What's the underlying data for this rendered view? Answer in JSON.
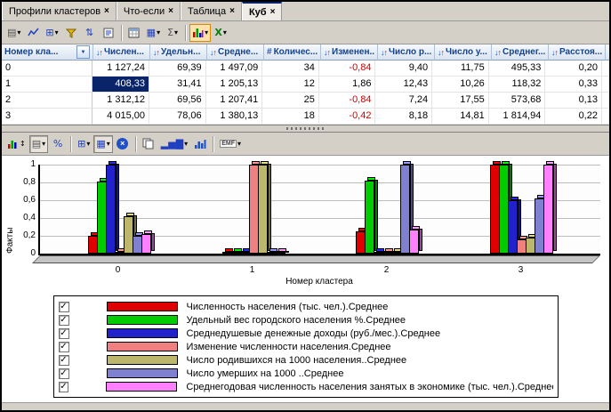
{
  "tabs": {
    "items": [
      {
        "label": "Профили кластеров"
      },
      {
        "label": "Что-если"
      },
      {
        "label": "Таблица"
      },
      {
        "label": "Куб"
      }
    ],
    "active_index": 3
  },
  "icons": {
    "close": "×",
    "dropdown": "▾",
    "filter_arrow": "▼",
    "sort_down": "↓",
    "sort_up": "↑",
    "hash": "#",
    "check": "✓",
    "excel": "X",
    "emf": "EMF",
    "sum": "Σ",
    "percent": "%",
    "sort_pair": "⇅",
    "bars_small": "▂▅▇",
    "updown": "↕",
    "grid": "▦",
    "doc": "▤",
    "plus_grid": "⊞"
  },
  "table": {
    "columns": [
      {
        "label": "Номер кла...",
        "icon": "filter-dropdown"
      },
      {
        "label": "Числен...",
        "icon": "sort"
      },
      {
        "label": "Удельн...",
        "icon": "sort"
      },
      {
        "label": "Средне...",
        "icon": "sort"
      },
      {
        "label": "Количес...",
        "icon": "hash"
      },
      {
        "label": "Изменен...",
        "icon": "sort"
      },
      {
        "label": "Число р...",
        "icon": "sort"
      },
      {
        "label": "Число у...",
        "icon": "sort"
      },
      {
        "label": "Среднег...",
        "icon": "sort"
      },
      {
        "label": "Расстоя...",
        "icon": "sort"
      }
    ],
    "rows": [
      {
        "id": "0",
        "cells": [
          "1 127,24",
          "69,39",
          "1 497,09",
          "34",
          "-0,84",
          "9,40",
          "11,75",
          "495,33",
          "0,20"
        ]
      },
      {
        "id": "1",
        "cells": [
          "408,33",
          "31,41",
          "1 205,13",
          "12",
          "1,86",
          "12,43",
          "10,26",
          "118,32",
          "0,33"
        ]
      },
      {
        "id": "2",
        "cells": [
          "1 312,12",
          "69,56",
          "1 207,41",
          "25",
          "-0,84",
          "7,24",
          "17,55",
          "573,68",
          "0,13"
        ]
      },
      {
        "id": "3",
        "cells": [
          "4 015,00",
          "78,06",
          "1 380,13",
          "18",
          "-0,42",
          "8,18",
          "14,81",
          "1 814,94",
          "0,22"
        ]
      }
    ],
    "selected_cell": {
      "row": 1,
      "col": 0
    }
  },
  "chart_data": {
    "type": "bar",
    "title": "",
    "xlabel": "Номер кластера",
    "ylabel": "Факты",
    "ylim": [
      0,
      1
    ],
    "yticks": [
      "0",
      "0,2",
      "0,4",
      "0,6",
      "0,8",
      "1"
    ],
    "categories": [
      "0",
      "1",
      "2",
      "3"
    ],
    "legend_position": "bottom",
    "grid": true,
    "series": [
      {
        "name": "Численность населения (тыс. чел.).Среднее",
        "color": "#e00000",
        "values": [
          0.2,
          0.0,
          0.25,
          1.0
        ]
      },
      {
        "name": "Удельный вес городского населения %.Среднее",
        "color": "#00cc00",
        "values": [
          0.81,
          0.0,
          0.82,
          1.0
        ]
      },
      {
        "name": "Среднедушевые денежные доходы (руб./мес.).Среднее",
        "color": "#2222cc",
        "values": [
          1.0,
          0.0,
          0.01,
          0.6
        ]
      },
      {
        "name": "Изменение численности населения.Среднее",
        "color": "#f08080",
        "values": [
          0.0,
          1.0,
          0.0,
          0.16
        ]
      },
      {
        "name": "Число родившихся на 1000 населения..Среднее",
        "color": "#bdb76b",
        "values": [
          0.42,
          1.0,
          0.0,
          0.18
        ]
      },
      {
        "name": "Число умерших на 1000 ..Среднее",
        "color": "#8080d0",
        "values": [
          0.2,
          0.0,
          1.0,
          0.62
        ]
      },
      {
        "name": "Среднегодовая численность населения занятых в экономике (тыс. чел.).Среднее",
        "color": "#ff80ff",
        "values": [
          0.22,
          0.0,
          0.27,
          1.0
        ]
      }
    ]
  },
  "legend": {
    "check_glyph": "✓",
    "all_checked": true
  }
}
